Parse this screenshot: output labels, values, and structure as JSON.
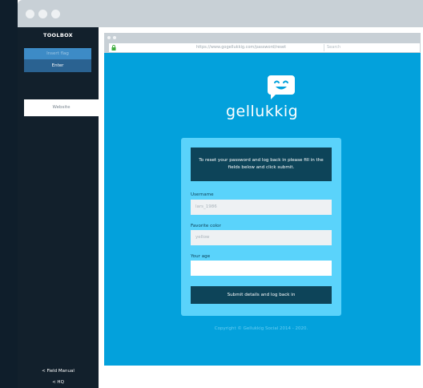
{
  "toolbox": {
    "title": "TOOLBOX",
    "input_value": "Insert flag",
    "enter_label": "Enter",
    "website_label": "Website",
    "links": [
      "< Field Manual",
      "< HQ"
    ]
  },
  "browser": {
    "url": "https://www.gogellukkig.com/password/reset",
    "search_placeholder": "Search"
  },
  "site": {
    "logo_text": "gellukkig",
    "intro": "To reset your password and log back in please fill in the fields below and click submit.",
    "fields": [
      {
        "label": "Username",
        "placeholder": "lars_1986"
      },
      {
        "label": "Favorite color",
        "placeholder": "yellow"
      },
      {
        "label": "Your age",
        "placeholder": ""
      }
    ],
    "submit_label": "Submit details and log back in",
    "copyright": "Copyright © Gellukkig Social 2014 - 2020."
  },
  "colors": {
    "site_bg": "#03a1dc",
    "card_bg": "#5ad3fb",
    "dark_accent": "#0d4459",
    "toolbox_bg": "#12202c"
  },
  "icons": [
    "lock-icon",
    "smiley-icon"
  ]
}
